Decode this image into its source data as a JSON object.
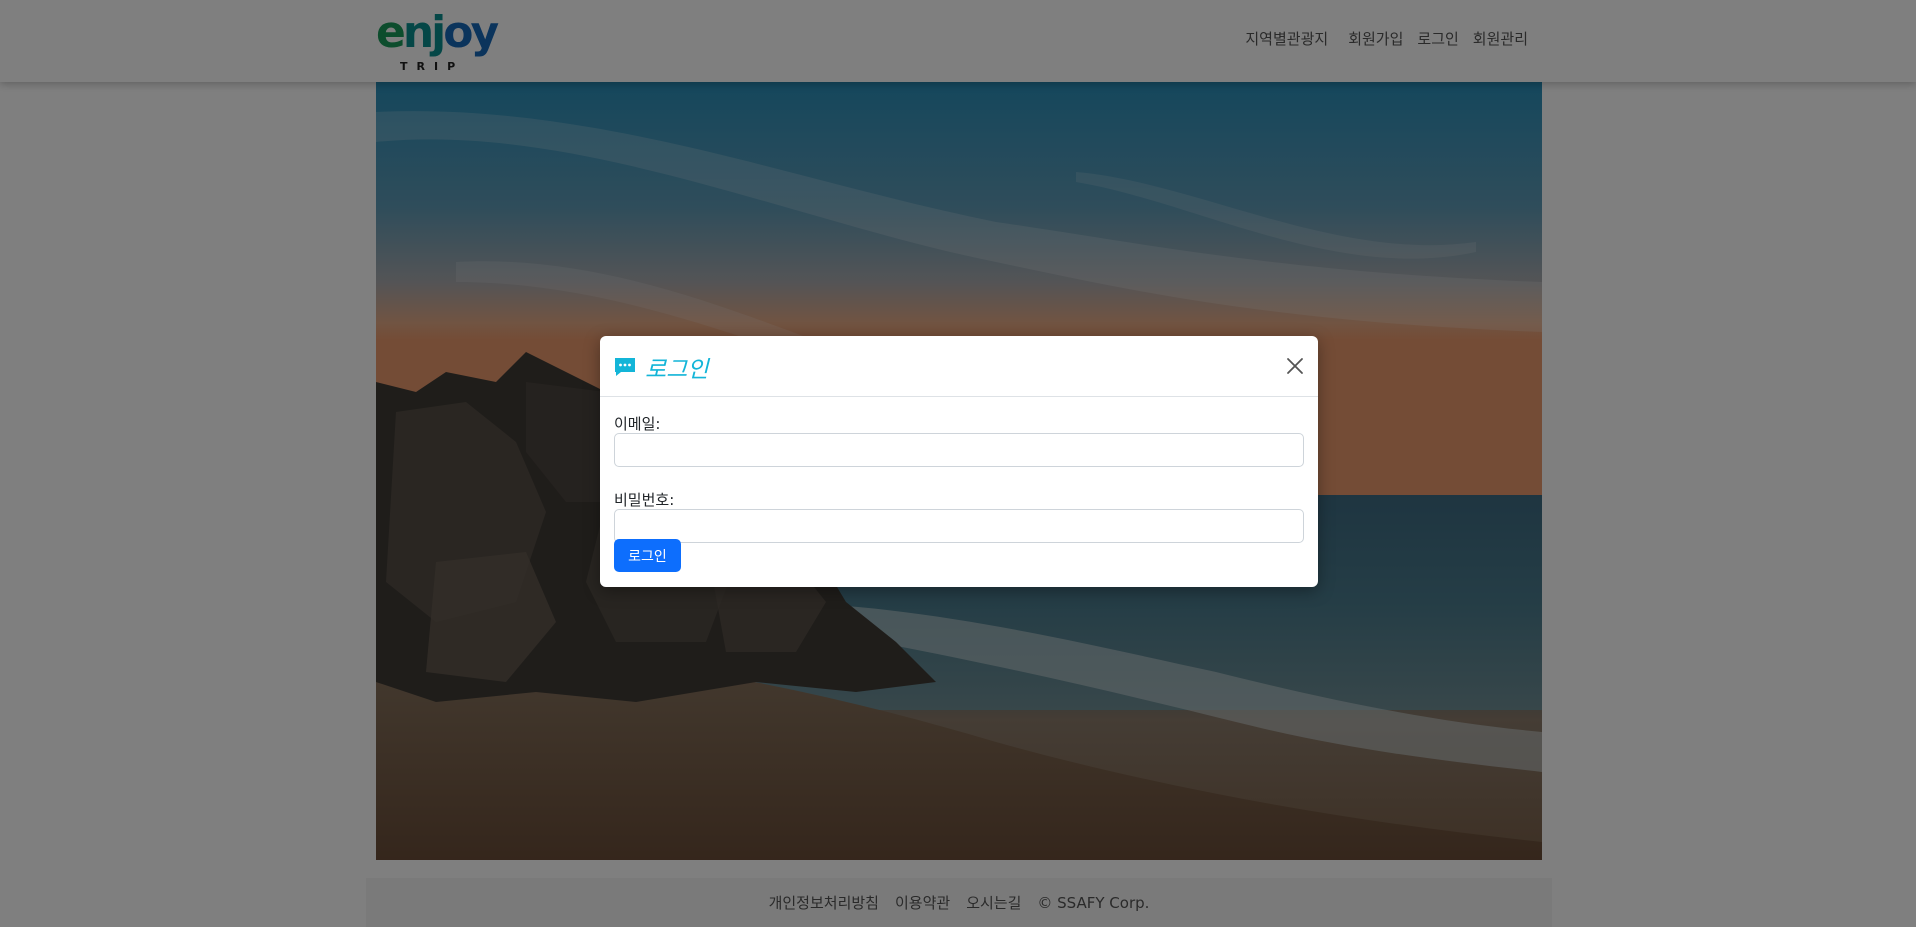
{
  "header": {
    "logo": {
      "text": "enjoy",
      "sub": "TRIP"
    },
    "nav": [
      {
        "label": "지역별관광지"
      },
      {
        "label": "회원가입"
      },
      {
        "label": "로그인"
      },
      {
        "label": "회원관리"
      }
    ]
  },
  "footer": {
    "links": [
      {
        "label": "개인정보처리방침"
      },
      {
        "label": "이용약관"
      },
      {
        "label": "오시는길"
      },
      {
        "label": "© SSAFY Corp."
      }
    ]
  },
  "modal": {
    "title": "로그인",
    "title_icon": "chat-dots-icon",
    "close_icon": "close-icon",
    "email": {
      "label": "이메일:",
      "value": "",
      "placeholder": ""
    },
    "password": {
      "label": "비밀번호:",
      "value": "",
      "placeholder": ""
    },
    "submit_label": "로그인"
  },
  "colors": {
    "title_accent": "#13b5d8",
    "primary_button": "#0d6efd",
    "logo_green": "#1a9a5a",
    "logo_teal": "#0b8f8f",
    "logo_blue": "#1769b8"
  }
}
